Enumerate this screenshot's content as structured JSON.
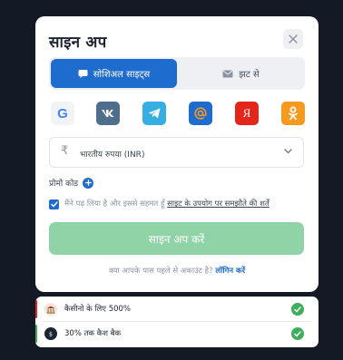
{
  "modal": {
    "title": "साइन अप",
    "tabs": [
      {
        "label": "सोशिअल साइट्स",
        "active": true,
        "icon": "chat-bubble-icon"
      },
      {
        "label": "झट से",
        "active": false,
        "icon": "envelope-icon"
      }
    ],
    "social": [
      {
        "name": "Google",
        "glyph": "G",
        "color": "#f1f3f6"
      },
      {
        "name": "VK",
        "color": "#4f6d8d"
      },
      {
        "name": "Telegram",
        "color": "#37aee2"
      },
      {
        "name": "Mail.ru",
        "color": "#1f6ccf"
      },
      {
        "name": "Yandex",
        "glyph": "Я",
        "color": "#e4261a"
      },
      {
        "name": "Odnoklassniki",
        "color": "#f59a1f"
      }
    ],
    "currency": {
      "symbol": "₹",
      "value": "भारतीय रुपया (INR)"
    },
    "promo_label": "प्रोमो कोड",
    "agreement": {
      "prefix": "मैंने पढ़ लिया है और इससे सहमत हूँ ",
      "link": "साइट के उपयोग पर समझौते की शर्तें",
      "checked": true
    },
    "signup_button": "साइन अप करें",
    "login_prompt": "क्या आपके पास पहले से अकाउंट है?",
    "login_link": "लॉगिन करें"
  },
  "bonuses": [
    {
      "text": "कैसीनो के लिए 500%",
      "checked": true
    },
    {
      "text": "30% तक कैश बैक",
      "checked": true
    }
  ],
  "colors": {
    "accent": "#1f6ccf",
    "signup_disabled": "#8fd3a6",
    "check_green": "#3fae5a",
    "background": "#141a25"
  }
}
